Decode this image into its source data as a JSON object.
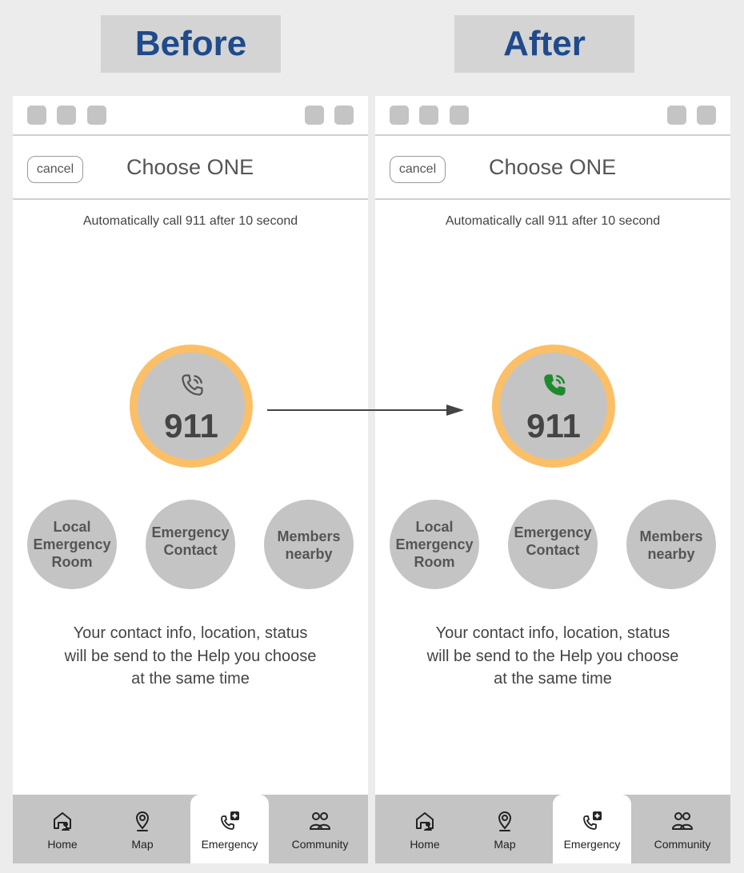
{
  "labels": {
    "before": "Before",
    "after": "After"
  },
  "screen": {
    "cancel_label": "cancel",
    "title": "Choose ONE",
    "auto_call_text": "Automatically call 911 after 10 second",
    "call_button_number": "911",
    "options": [
      {
        "line1": "Local",
        "line2": "Emergency",
        "line3": "Room"
      },
      {
        "line1": "Emergency",
        "line2": "Contact"
      },
      {
        "line1": "Members",
        "line2": "nearby"
      }
    ],
    "info_lines": [
      "Your contact info, location, status",
      "will be send to the Help you choose",
      "at the same time"
    ],
    "tabs": [
      {
        "label": "Home",
        "icon": "home-icon"
      },
      {
        "label": "Map",
        "icon": "map-pin-icon"
      },
      {
        "label": "Emergency",
        "icon": "emergency-call-icon",
        "active": true
      },
      {
        "label": "Community",
        "icon": "community-icon"
      }
    ]
  },
  "colors": {
    "label_text": "#1f4a8c",
    "ring": "#fbbf68",
    "circle": "#c4c4c4",
    "phone_icon_before": "#555555",
    "phone_icon_after": "#1e8a2e"
  }
}
